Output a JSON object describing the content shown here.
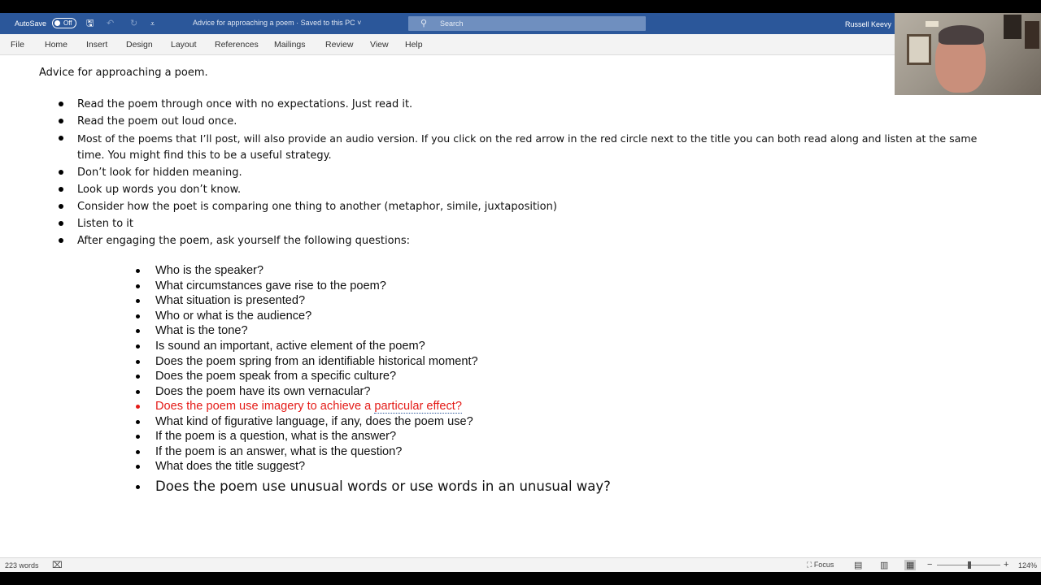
{
  "titlebar": {
    "autosave": "AutoSave",
    "toggle": "Off",
    "doc_title": "Advice for approaching a poem  ·  Saved to this PC  ˅",
    "search_placeholder": "Search",
    "user": "Russell Keevy",
    "icons": [
      "save-icon",
      "undo-icon",
      "redo-icon",
      "customize-icon",
      "search-icon"
    ]
  },
  "ribbon": {
    "tabs": [
      "File",
      "Home",
      "Insert",
      "Design",
      "Layout",
      "References",
      "Mailings",
      "Review",
      "View",
      "Help"
    ]
  },
  "document": {
    "heading": "Advice for approaching a poem.",
    "bullets": [
      "Read the poem through once with no expectations. Just read it.",
      "Read the poem out loud once.",
      "Most of the poems that I’ll post, will also provide an audio version.  If you click on the red arrow in the red circle next to the title you can both read along and listen at the same",
      "time.  You might find this to be a useful strategy.",
      "Don’t look for hidden meaning.",
      "Look up words you don’t know.",
      "Consider how the poet is comparing one thing to another (metaphor, simile, juxtaposition)",
      "Listen to it",
      "After engaging the poem, ask yourself the following questions:"
    ],
    "questions": [
      "Who is the speaker?",
      "What circumstances gave rise to the poem?",
      "What situation is presented?",
      "Who or what is the audience?",
      "What is the tone?",
      "Is sound an important, active element of the poem?",
      "Does the poem spring from an identifiable historical moment?",
      "Does the poem speak from a specific culture?",
      "Does the poem have its own vernacular?",
      "Does the poem use imagery to achieve a ",
      "particular effect?",
      "What kind of figurative language, if any, does the poem use?",
      "If the poem is a question, what is the answer?",
      "If the poem is an answer, what is the question?",
      "What does the title suggest?",
      "Does the poem use unusual words or use words in an unusual way?"
    ],
    "highlight_color": "#e41b17"
  },
  "statusbar": {
    "word_count": "223 words",
    "focus": "Focus",
    "zoom": "124%",
    "zoom_out": "−",
    "zoom_in": "+"
  }
}
